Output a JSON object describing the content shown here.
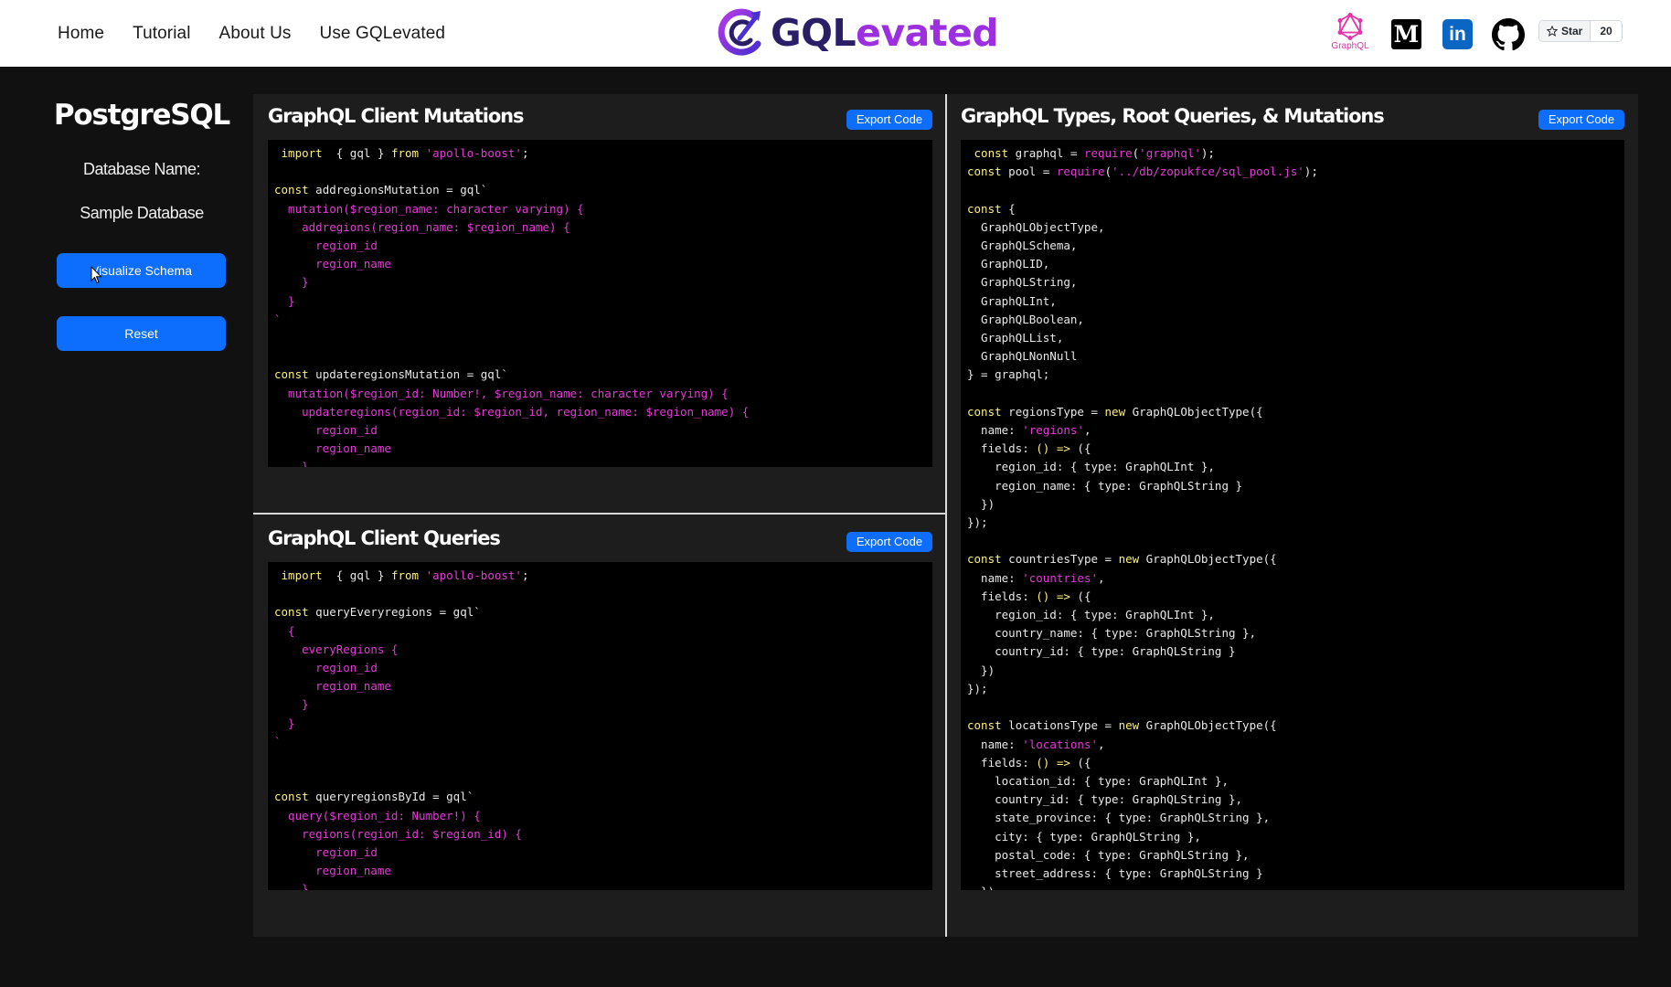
{
  "nav": {
    "links": [
      "Home",
      "Tutorial",
      "About Us",
      "Use GQLevated"
    ],
    "brand_left": "GQL",
    "brand_right": "evated",
    "graphql_label": "GraphQL",
    "medium_letter": "M",
    "linkedin_letters": "in",
    "star_label": "Star",
    "star_count": "20"
  },
  "sidebar": {
    "title": "PostgreSQL",
    "db_label": "Database Name:",
    "db_value": "Sample Database",
    "visualize_label": "Visualize Schema",
    "reset_label": "Reset"
  },
  "panels": {
    "mutations_title": "GraphQL Client Mutations",
    "queries_title": "GraphQL Client Queries",
    "types_title": "GraphQL Types, Root Queries, & Mutations",
    "export_label": "Export Code"
  },
  "colors": {
    "accent": "#0d6efd",
    "keyword": "#fdf07a",
    "string": "#e53ad7",
    "brand_dark": "#2a1f66",
    "brand_purple": "#9c2fe0"
  },
  "code": {
    "mutations": [
      [
        [
          "kw",
          " import"
        ],
        [
          "",
          "  { gql } "
        ],
        [
          "kw",
          "from"
        ],
        [
          "",
          " "
        ],
        [
          "str",
          "'apollo-boost'"
        ],
        [
          "",
          ";"
        ]
      ],
      [],
      [
        [
          "kw",
          "const"
        ],
        [
          "",
          " addregionsMutation = gql`"
        ]
      ],
      [
        [
          "gq",
          "  mutation($region_name: character varying) {"
        ]
      ],
      [
        [
          "gq",
          "    addregions(region_name: $region_name) {"
        ]
      ],
      [
        [
          "gq",
          "      region_id"
        ]
      ],
      [
        [
          "gq",
          "      region_name"
        ]
      ],
      [
        [
          "gq",
          "    }"
        ]
      ],
      [
        [
          "gq",
          "  }"
        ]
      ],
      [
        [
          "gq",
          "`"
        ]
      ],
      [],
      [],
      [
        [
          "kw",
          "const"
        ],
        [
          "",
          " updateregionsMutation = gql`"
        ]
      ],
      [
        [
          "gq",
          "  mutation($region_id: Number!, $region_name: character varying) {"
        ]
      ],
      [
        [
          "gq",
          "    updateregions(region_id: $region_id, region_name: $region_name) {"
        ]
      ],
      [
        [
          "gq",
          "      region_id"
        ]
      ],
      [
        [
          "gq",
          "      region_name"
        ]
      ],
      [
        [
          "gq",
          "    }"
        ]
      ],
      [
        [
          "gq",
          "  }"
        ]
      ]
    ],
    "queries": [
      [
        [
          "kw",
          " import"
        ],
        [
          "",
          "  { gql } "
        ],
        [
          "kw",
          "from"
        ],
        [
          "",
          " "
        ],
        [
          "str",
          "'apollo-boost'"
        ],
        [
          "",
          ";"
        ]
      ],
      [],
      [
        [
          "kw",
          "const"
        ],
        [
          "",
          " queryEveryregions = gql`"
        ]
      ],
      [
        [
          "gq",
          "  {"
        ]
      ],
      [
        [
          "gq",
          "    everyRegions {"
        ]
      ],
      [
        [
          "gq",
          "      region_id"
        ]
      ],
      [
        [
          "gq",
          "      region_name"
        ]
      ],
      [
        [
          "gq",
          "    }"
        ]
      ],
      [
        [
          "gq",
          "  }"
        ]
      ],
      [
        [
          "gq",
          "`"
        ]
      ],
      [],
      [],
      [
        [
          "kw",
          "const"
        ],
        [
          "",
          " queryregionsById = gql`"
        ]
      ],
      [
        [
          "gq",
          "  query($region_id: Number!) {"
        ]
      ],
      [
        [
          "gq",
          "    regions(region_id: $region_id) {"
        ]
      ],
      [
        [
          "gq",
          "      region_id"
        ]
      ],
      [
        [
          "gq",
          "      region_name"
        ]
      ],
      [
        [
          "gq",
          "    }"
        ]
      ],
      [
        [
          "gq",
          "  }"
        ]
      ]
    ],
    "types": [
      [
        [
          "kw",
          " const"
        ],
        [
          "",
          " graphql = "
        ],
        [
          "fn",
          "require"
        ],
        [
          "",
          "("
        ],
        [
          "str",
          "'graphql'"
        ],
        [
          "",
          ");"
        ]
      ],
      [
        [
          "kw",
          "const"
        ],
        [
          "",
          " pool = "
        ],
        [
          "fn",
          "require"
        ],
        [
          "",
          "("
        ],
        [
          "str",
          "'../db/zopukfce/sql_pool.js'"
        ],
        [
          "",
          ");"
        ]
      ],
      [],
      [
        [
          "kw",
          "const"
        ],
        [
          "",
          " {"
        ]
      ],
      [
        [
          "",
          "  GraphQLObjectType,"
        ]
      ],
      [
        [
          "",
          "  GraphQLSchema,"
        ]
      ],
      [
        [
          "",
          "  GraphQLID,"
        ]
      ],
      [
        [
          "",
          "  GraphQLString,"
        ]
      ],
      [
        [
          "",
          "  GraphQLInt,"
        ]
      ],
      [
        [
          "",
          "  GraphQLBoolean,"
        ]
      ],
      [
        [
          "",
          "  GraphQLList,"
        ]
      ],
      [
        [
          "",
          "  GraphQLNonNull"
        ]
      ],
      [
        [
          "",
          "} = graphql;"
        ]
      ],
      [],
      [
        [
          "kw",
          "const"
        ],
        [
          "",
          " regionsType = "
        ],
        [
          "kw",
          "new"
        ],
        [
          "",
          " GraphQLObjectType({"
        ]
      ],
      [
        [
          "",
          "  name: "
        ],
        [
          "str",
          "'regions'"
        ],
        [
          "",
          ","
        ]
      ],
      [
        [
          "",
          "  fields: "
        ],
        [
          "kw",
          "() =>"
        ],
        [
          "",
          " ({"
        ]
      ],
      [
        [
          "",
          "    region_id: { type: GraphQLInt },"
        ]
      ],
      [
        [
          "",
          "    region_name: { type: GraphQLString }"
        ]
      ],
      [
        [
          "",
          "  })"
        ]
      ],
      [
        [
          "",
          "});"
        ]
      ],
      [],
      [
        [
          "kw",
          "const"
        ],
        [
          "",
          " countriesType = "
        ],
        [
          "kw",
          "new"
        ],
        [
          "",
          " GraphQLObjectType({"
        ]
      ],
      [
        [
          "",
          "  name: "
        ],
        [
          "str",
          "'countries'"
        ],
        [
          "",
          ","
        ]
      ],
      [
        [
          "",
          "  fields: "
        ],
        [
          "kw",
          "() =>"
        ],
        [
          "",
          " ({"
        ]
      ],
      [
        [
          "",
          "    region_id: { type: GraphQLInt },"
        ]
      ],
      [
        [
          "",
          "    country_name: { type: GraphQLString },"
        ]
      ],
      [
        [
          "",
          "    country_id: { type: GraphQLString }"
        ]
      ],
      [
        [
          "",
          "  })"
        ]
      ],
      [
        [
          "",
          "});"
        ]
      ],
      [],
      [
        [
          "kw",
          "const"
        ],
        [
          "",
          " locationsType = "
        ],
        [
          "kw",
          "new"
        ],
        [
          "",
          " GraphQLObjectType({"
        ]
      ],
      [
        [
          "",
          "  name: "
        ],
        [
          "str",
          "'locations'"
        ],
        [
          "",
          ","
        ]
      ],
      [
        [
          "",
          "  fields: "
        ],
        [
          "kw",
          "() =>"
        ],
        [
          "",
          " ({"
        ]
      ],
      [
        [
          "",
          "    location_id: { type: GraphQLInt },"
        ]
      ],
      [
        [
          "",
          "    country_id: { type: GraphQLString },"
        ]
      ],
      [
        [
          "",
          "    state_province: { type: GraphQLString },"
        ]
      ],
      [
        [
          "",
          "    city: { type: GraphQLString },"
        ]
      ],
      [
        [
          "",
          "    postal_code: { type: GraphQLString },"
        ]
      ],
      [
        [
          "",
          "    street_address: { type: GraphQLString }"
        ]
      ],
      [
        [
          "",
          "  })"
        ]
      ]
    ]
  }
}
